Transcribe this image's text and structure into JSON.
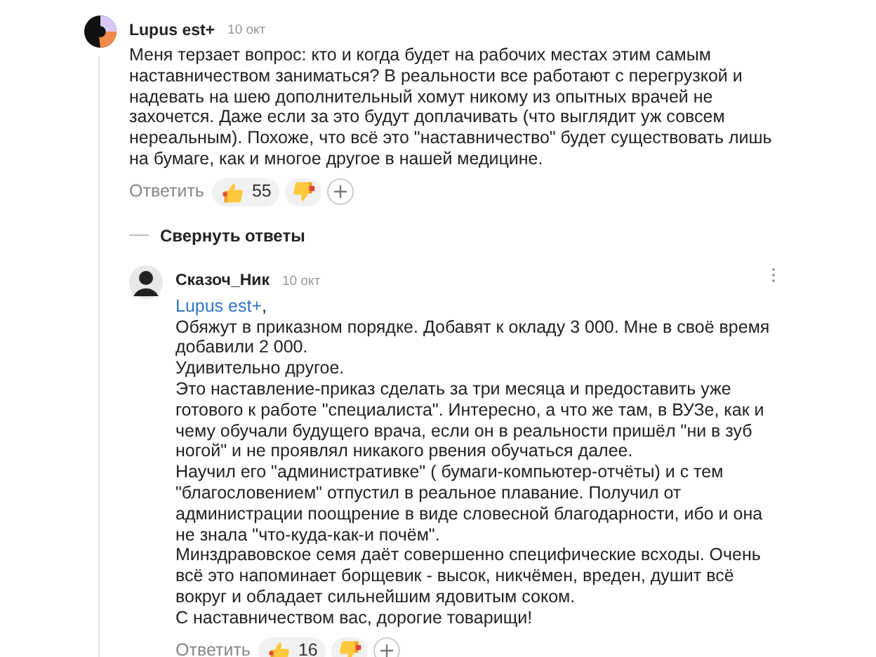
{
  "comment": {
    "author": "Lupus est+",
    "date": "10 окт",
    "paragraphs": [
      "Меня терзает вопрос: кто и когда будет на рабочих местах этим самым наставничеством заниматься? В реальности все работают с перегрузкой и надевать на шею дополнительный хомут никому из опытных врачей не захочется. Даже если за это будут доплачивать (что выглядит уж совсем нереальным). Похоже, что всё это \"наставничество\" будет существовать лишь на бумаге, как и многое другое в нашей медицине."
    ],
    "reply_label": "Ответить",
    "likes": "55"
  },
  "collapse_label": "Свернуть ответы",
  "reply": {
    "author": "Сказоч_Ник",
    "date": "10 окт",
    "mention": "Lupus est+",
    "mention_suffix": ",",
    "paragraphs": [
      "Обяжут в приказном порядке. Добавят к окладу 3 000. Мне в своё время добавили 2 000.",
      "Удивительно другое.",
      "Это наставление-приказ сделать за три месяца и предоставить уже готового к работе \"специалиста\". Интересно, а что же там, в ВУЗе, как и чему обучали будущего врача, если он в реальности пришёл \"ни в зуб ногой\" и не проявлял никакого рвения обучаться далее.",
      "Научил его \"административке\" ( бумаги-компьютер-отчёты) и с тем \"благословением\" отпустил в реальное плавание. Получил от администрации поощрение в виде словесной благодарности, ибо и она не знала \"что-куда-как-и почём\".",
      "Минздравовское семя даёт совершенно специфические всходы. Очень всё это напоминает борщевик - высок, никчёмен, вреден, душит всё вокруг и обладает сильнейшим ядовитым соком.",
      "С наставничеством вас, дорогие товарищи!"
    ],
    "reply_label": "Ответить",
    "likes": "16"
  }
}
